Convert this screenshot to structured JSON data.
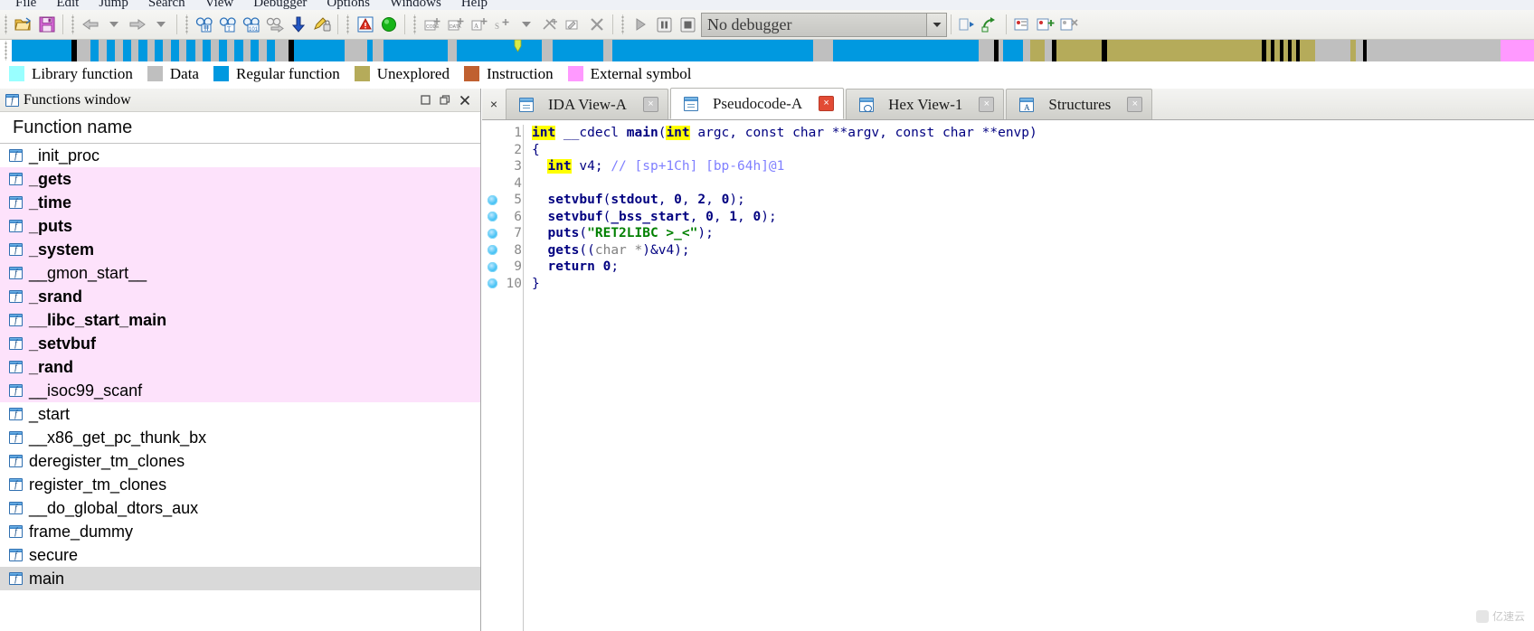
{
  "menu": {
    "items": [
      "File",
      "Edit",
      "Jump",
      "Search",
      "View",
      "Debugger",
      "Options",
      "Windows",
      "Help"
    ]
  },
  "toolbar": {
    "debugger_select_value": "No debugger",
    "buttons": [
      {
        "name": "open-file-icon",
        "glyph": "folder-open"
      },
      {
        "name": "save-icon",
        "glyph": "floppy"
      },
      {
        "name": "nav-back-icon",
        "glyph": "arrow-left"
      },
      {
        "name": "nav-back-dropdown-icon",
        "glyph": "caret-down"
      },
      {
        "name": "nav-forward-icon",
        "glyph": "arrow-right"
      },
      {
        "name": "nav-forward-dropdown-icon",
        "glyph": "caret-down"
      },
      {
        "name": "search-binary-icon",
        "glyph": "binoculars-hash"
      },
      {
        "name": "search-text-icon",
        "glyph": "binoculars-text"
      },
      {
        "name": "search-sequence-icon",
        "glyph": "binoculars-101"
      },
      {
        "name": "jump-xref-icon",
        "glyph": "binoculars-arrow"
      },
      {
        "name": "jump-address-icon",
        "glyph": "arrow-down-blue"
      },
      {
        "name": "produce-output-icon",
        "glyph": "pencil-lock"
      },
      {
        "name": "warnings-icon",
        "glyph": "red-triangle"
      },
      {
        "name": "analysis-indicator-icon",
        "glyph": "green-circle"
      },
      {
        "name": "make-code-icon",
        "glyph": "code-plus"
      },
      {
        "name": "make-data-icon",
        "glyph": "data-plus"
      },
      {
        "name": "make-array-icon",
        "glyph": "array-plus"
      },
      {
        "name": "make-struct-icon",
        "glyph": "struct-plus"
      },
      {
        "name": "make-struct-dropdown-icon",
        "glyph": "caret-down"
      },
      {
        "name": "undefine-icon",
        "glyph": "undefine"
      },
      {
        "name": "rename-icon",
        "glyph": "rename"
      },
      {
        "name": "delete-icon",
        "glyph": "x-mark"
      },
      {
        "name": "run-icon",
        "glyph": "play"
      },
      {
        "name": "pause-icon",
        "glyph": "pause"
      },
      {
        "name": "stop-icon",
        "glyph": "stop"
      },
      {
        "name": "step-into-icon",
        "glyph": "step-1"
      },
      {
        "name": "step-over-icon",
        "glyph": "step-2"
      },
      {
        "name": "breakpoints-icon",
        "glyph": "bp-list"
      },
      {
        "name": "add-breakpoint-icon",
        "glyph": "bp-add"
      },
      {
        "name": "clear-breakpoints-icon",
        "glyph": "bp-clear"
      }
    ]
  },
  "navband": {
    "cursor_x_pct": 33.0,
    "segments": [
      {
        "color": "#0099e0",
        "w": 3.9
      },
      {
        "color": "#000000",
        "w": 0.35
      },
      {
        "color": "#bfbfbf",
        "w": 0.9
      },
      {
        "color": "#0099e0",
        "w": 0.55
      },
      {
        "color": "#bfbfbf",
        "w": 0.55
      },
      {
        "color": "#0099e0",
        "w": 0.55
      },
      {
        "color": "#bfbfbf",
        "w": 0.5
      },
      {
        "color": "#0099e0",
        "w": 0.55
      },
      {
        "color": "#bfbfbf",
        "w": 0.5
      },
      {
        "color": "#0099e0",
        "w": 0.55
      },
      {
        "color": "#bfbfbf",
        "w": 0.5
      },
      {
        "color": "#0099e0",
        "w": 0.55
      },
      {
        "color": "#bfbfbf",
        "w": 0.5
      },
      {
        "color": "#0099e0",
        "w": 0.55
      },
      {
        "color": "#bfbfbf",
        "w": 0.5
      },
      {
        "color": "#0099e0",
        "w": 0.55
      },
      {
        "color": "#bfbfbf",
        "w": 0.5
      },
      {
        "color": "#0099e0",
        "w": 0.55
      },
      {
        "color": "#bfbfbf",
        "w": 0.5
      },
      {
        "color": "#0099e0",
        "w": 0.55
      },
      {
        "color": "#bfbfbf",
        "w": 0.5
      },
      {
        "color": "#0099e0",
        "w": 0.55
      },
      {
        "color": "#bfbfbf",
        "w": 0.5
      },
      {
        "color": "#0099e0",
        "w": 0.55
      },
      {
        "color": "#bfbfbf",
        "w": 0.5
      },
      {
        "color": "#0099e0",
        "w": 0.55
      },
      {
        "color": "#bfbfbf",
        "w": 0.9
      },
      {
        "color": "#000000",
        "w": 0.35
      },
      {
        "color": "#0099e0",
        "w": 3.3
      },
      {
        "color": "#bfbfbf",
        "w": 1.5
      },
      {
        "color": "#0099e0",
        "w": 0.4
      },
      {
        "color": "#bfbfbf",
        "w": 0.7
      },
      {
        "color": "#0099e0",
        "w": 4.2
      },
      {
        "color": "#bfbfbf",
        "w": 0.6
      },
      {
        "color": "#0099e0",
        "w": 5.6
      },
      {
        "color": "#bfbfbf",
        "w": 0.7
      },
      {
        "color": "#0099e0",
        "w": 3.3
      },
      {
        "color": "#bfbfbf",
        "w": 0.6
      },
      {
        "color": "#0099e0",
        "w": 13.2
      },
      {
        "color": "#bfbfbf",
        "w": 1.3
      },
      {
        "color": "#0099e0",
        "w": 9.6
      },
      {
        "color": "#bfbfbf",
        "w": 1.0
      },
      {
        "color": "#000000",
        "w": 0.3
      },
      {
        "color": "#bfbfbf",
        "w": 0.3
      },
      {
        "color": "#0099e0",
        "w": 1.3
      },
      {
        "color": "#bfbfbf",
        "w": 0.5
      },
      {
        "color": "#b5ab5a",
        "w": 0.9
      },
      {
        "color": "#bfbfbf",
        "w": 0.5
      },
      {
        "color": "#000000",
        "w": 0.3
      },
      {
        "color": "#b5ab5a",
        "w": 3.0
      },
      {
        "color": "#000000",
        "w": 0.3
      },
      {
        "color": "#b5ab5a",
        "w": 10.2
      },
      {
        "color": "#000000",
        "w": 0.3
      },
      {
        "color": "#b5ab5a",
        "w": 0.3
      },
      {
        "color": "#000000",
        "w": 0.25
      },
      {
        "color": "#b5ab5a",
        "w": 0.3
      },
      {
        "color": "#000000",
        "w": 0.25
      },
      {
        "color": "#b5ab5a",
        "w": 0.3
      },
      {
        "color": "#000000",
        "w": 0.25
      },
      {
        "color": "#b5ab5a",
        "w": 0.3
      },
      {
        "color": "#000000",
        "w": 0.25
      },
      {
        "color": "#b5ab5a",
        "w": 1.0
      },
      {
        "color": "#bfbfbf",
        "w": 2.3
      },
      {
        "color": "#b5ab5a",
        "w": 0.35
      },
      {
        "color": "#bfbfbf",
        "w": 0.5
      },
      {
        "color": "#000000",
        "w": 0.25
      },
      {
        "color": "#bfbfbf",
        "w": 8.8
      },
      {
        "color": "#ff99ff",
        "w": 5.5
      },
      {
        "color": "#000000",
        "w": 11.2
      }
    ]
  },
  "legend": {
    "items": [
      {
        "label": "Library function",
        "color": "#99ffff"
      },
      {
        "label": "Data",
        "color": "#bfbfbf"
      },
      {
        "label": "Regular function",
        "color": "#0099e0"
      },
      {
        "label": "Unexplored",
        "color": "#b5ab5a"
      },
      {
        "label": "Instruction",
        "color": "#c06030"
      },
      {
        "label": "External symbol",
        "color": "#ff99ff"
      }
    ]
  },
  "functions_window": {
    "title": "Functions window",
    "title_icon": "function-icon",
    "maximize_icon": "maximize-icon",
    "restore_icon": "restore-icon",
    "close_icon": "close-icon",
    "column_header": "Function name",
    "rows": [
      {
        "name": "_init_proc",
        "highlight": false,
        "bold": false,
        "selected": false
      },
      {
        "name": "_gets",
        "highlight": true,
        "bold": true,
        "selected": false
      },
      {
        "name": "_time",
        "highlight": true,
        "bold": true,
        "selected": false
      },
      {
        "name": "_puts",
        "highlight": true,
        "bold": true,
        "selected": false
      },
      {
        "name": "_system",
        "highlight": true,
        "bold": true,
        "selected": false
      },
      {
        "name": "__gmon_start__",
        "highlight": true,
        "bold": false,
        "selected": false
      },
      {
        "name": "_srand",
        "highlight": true,
        "bold": true,
        "selected": false
      },
      {
        "name": "__libc_start_main",
        "highlight": true,
        "bold": true,
        "selected": false
      },
      {
        "name": "_setvbuf",
        "highlight": true,
        "bold": true,
        "selected": false
      },
      {
        "name": "_rand",
        "highlight": true,
        "bold": true,
        "selected": false
      },
      {
        "name": "__isoc99_scanf",
        "highlight": true,
        "bold": false,
        "selected": false
      },
      {
        "name": "_start",
        "highlight": false,
        "bold": false,
        "selected": false
      },
      {
        "name": "__x86_get_pc_thunk_bx",
        "highlight": false,
        "bold": false,
        "selected": false
      },
      {
        "name": "deregister_tm_clones",
        "highlight": false,
        "bold": false,
        "selected": false
      },
      {
        "name": "register_tm_clones",
        "highlight": false,
        "bold": false,
        "selected": false
      },
      {
        "name": "__do_global_dtors_aux",
        "highlight": false,
        "bold": false,
        "selected": false
      },
      {
        "name": "frame_dummy",
        "highlight": false,
        "bold": false,
        "selected": false
      },
      {
        "name": "secure",
        "highlight": false,
        "bold": false,
        "selected": false
      },
      {
        "name": "main",
        "highlight": false,
        "bold": false,
        "selected": true
      }
    ]
  },
  "tabs": {
    "close_left_glyph": "×",
    "items": [
      {
        "label": "IDA View-A",
        "icon": "document-icon",
        "active": false,
        "close_label": "×"
      },
      {
        "label": "Pseudocode-A",
        "icon": "document-icon",
        "active": true,
        "close_label": "×"
      },
      {
        "label": "Hex View-1",
        "icon": "hex-view-icon",
        "active": false,
        "close_label": "×"
      },
      {
        "label": "Structures",
        "icon": "structures-icon",
        "active": false,
        "close_label": "×"
      }
    ]
  },
  "pseudocode": {
    "lines": [
      {
        "n": "1",
        "bp": false,
        "tokens": [
          {
            "t": "int",
            "c": "kw"
          },
          {
            "t": " __cdecl ",
            "c": "punc"
          },
          {
            "t": "main",
            "c": "fn"
          },
          {
            "t": "(",
            "c": "punc"
          },
          {
            "t": "int",
            "c": "kw"
          },
          {
            "t": " argc, ",
            "c": "punc"
          },
          {
            "t": "const char **argv, const char **envp",
            "c": "punc"
          },
          {
            "t": ")",
            "c": "punc"
          }
        ]
      },
      {
        "n": "2",
        "bp": false,
        "tokens": [
          {
            "t": "{",
            "c": "punc"
          }
        ]
      },
      {
        "n": "3",
        "bp": false,
        "tokens": [
          {
            "t": "  ",
            "c": "punc"
          },
          {
            "t": "int",
            "c": "kw"
          },
          {
            "t": " v4; ",
            "c": "punc"
          },
          {
            "t": "// [sp+1Ch] [bp-64h]@1",
            "c": "cmt"
          }
        ]
      },
      {
        "n": "4",
        "bp": false,
        "tokens": [
          {
            "t": "",
            "c": "punc"
          }
        ]
      },
      {
        "n": "5",
        "bp": true,
        "tokens": [
          {
            "t": "  ",
            "c": "punc"
          },
          {
            "t": "setvbuf",
            "c": "fn"
          },
          {
            "t": "(",
            "c": "punc"
          },
          {
            "t": "stdout",
            "c": "gbl"
          },
          {
            "t": ", ",
            "c": "punc"
          },
          {
            "t": "0",
            "c": "num"
          },
          {
            "t": ", ",
            "c": "punc"
          },
          {
            "t": "2",
            "c": "num"
          },
          {
            "t": ", ",
            "c": "punc"
          },
          {
            "t": "0",
            "c": "num"
          },
          {
            "t": ");",
            "c": "punc"
          }
        ]
      },
      {
        "n": "6",
        "bp": true,
        "tokens": [
          {
            "t": "  ",
            "c": "punc"
          },
          {
            "t": "setvbuf",
            "c": "fn"
          },
          {
            "t": "(",
            "c": "punc"
          },
          {
            "t": "_bss_start",
            "c": "gbl"
          },
          {
            "t": ", ",
            "c": "punc"
          },
          {
            "t": "0",
            "c": "num"
          },
          {
            "t": ", ",
            "c": "punc"
          },
          {
            "t": "1",
            "c": "num"
          },
          {
            "t": ", ",
            "c": "punc"
          },
          {
            "t": "0",
            "c": "num"
          },
          {
            "t": ");",
            "c": "punc"
          }
        ]
      },
      {
        "n": "7",
        "bp": true,
        "tokens": [
          {
            "t": "  ",
            "c": "punc"
          },
          {
            "t": "puts",
            "c": "fn"
          },
          {
            "t": "(",
            "c": "punc"
          },
          {
            "t": "\"RET2LIBC >_<\"",
            "c": "str"
          },
          {
            "t": ");",
            "c": "punc"
          }
        ]
      },
      {
        "n": "8",
        "bp": true,
        "tokens": [
          {
            "t": "  ",
            "c": "punc"
          },
          {
            "t": "gets",
            "c": "fn"
          },
          {
            "t": "((",
            "c": "punc"
          },
          {
            "t": "char *",
            "c": "typ"
          },
          {
            "t": ")&",
            "c": "punc"
          },
          {
            "t": "v4",
            "c": "var"
          },
          {
            "t": ");",
            "c": "punc"
          }
        ]
      },
      {
        "n": "9",
        "bp": true,
        "tokens": [
          {
            "t": "  ",
            "c": "punc"
          },
          {
            "t": "return",
            "c": "fn"
          },
          {
            "t": " ",
            "c": "punc"
          },
          {
            "t": "0",
            "c": "num"
          },
          {
            "t": ";",
            "c": "punc"
          }
        ]
      },
      {
        "n": "10",
        "bp": true,
        "tokens": [
          {
            "t": "}",
            "c": "punc"
          }
        ]
      }
    ]
  },
  "watermark": {
    "text": "亿速云"
  }
}
